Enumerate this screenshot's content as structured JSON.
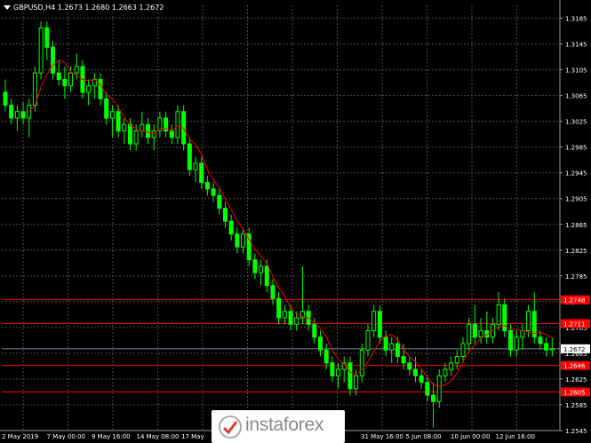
{
  "chart_title": "GBPUSD,H4  1.2673 1.2680 1.2663 1.2672",
  "colors": {
    "background": "#000000",
    "candles": "#00ff00",
    "moving_average": "#ff0000",
    "level_lines": "#ff0000",
    "price_label_bg": "#ff0000",
    "grid": "#4d4d4d",
    "current_price_line": "#778899"
  },
  "watermark_text": "instaforex",
  "watermark_icon": "instaforex-logo-icon",
  "chart_data": {
    "type": "candlestick",
    "symbol": "GBPUSD",
    "timeframe": "H4",
    "ohlc_header": {
      "open": 1.2673,
      "high": 1.268,
      "low": 1.2663,
      "close": 1.2672
    },
    "ylim": [
      1.2545,
      1.3205
    ],
    "y_ticks": [
      "1.3185",
      "1.3145",
      "1.3105",
      "1.3065",
      "1.3025",
      "1.2985",
      "1.2945",
      "1.2905",
      "1.2865",
      "1.2825",
      "1.2785",
      "1.2745",
      "1.2705",
      "1.2665",
      "1.2625",
      "1.2585",
      "1.2545"
    ],
    "x_ticks": [
      "2 May 2019",
      "7 May 00:00",
      "9 May 16:00",
      "14 May 08:00",
      "17 May",
      "",
      "",
      "",
      "31 May 16:00",
      "5 Jun 08:00",
      "10 Jun 00:00",
      "12 Jun 16:00"
    ],
    "current_price": "1.2672",
    "levels": [
      {
        "price": 1.2748,
        "label": "1.2748"
      },
      {
        "price": 1.2711,
        "label": "1.2711"
      },
      {
        "price": 1.2646,
        "label": "1.2646"
      },
      {
        "price": 1.2605,
        "label": "1.2605"
      }
    ],
    "candles": [
      [
        1.307,
        1.309,
        1.304,
        1.305
      ],
      [
        1.305,
        1.306,
        1.302,
        1.303
      ],
      [
        1.303,
        1.305,
        1.301,
        1.304
      ],
      [
        1.304,
        1.3055,
        1.302,
        1.303
      ],
      [
        1.303,
        1.306,
        1.3,
        1.305
      ],
      [
        1.305,
        1.311,
        1.304,
        1.31
      ],
      [
        1.31,
        1.318,
        1.309,
        1.317
      ],
      [
        1.317,
        1.318,
        1.312,
        1.314
      ],
      [
        1.314,
        1.315,
        1.309,
        1.31
      ],
      [
        1.31,
        1.312,
        1.308,
        1.309
      ],
      [
        1.309,
        1.311,
        1.306,
        1.308
      ],
      [
        1.308,
        1.311,
        1.307,
        1.31
      ],
      [
        1.31,
        1.313,
        1.309,
        1.311
      ],
      [
        1.311,
        1.312,
        1.306,
        1.307
      ],
      [
        1.307,
        1.309,
        1.305,
        1.308
      ],
      [
        1.308,
        1.31,
        1.306,
        1.309
      ],
      [
        1.309,
        1.31,
        1.305,
        1.306
      ],
      [
        1.306,
        1.307,
        1.302,
        1.303
      ],
      [
        1.303,
        1.305,
        1.3,
        1.304
      ],
      [
        1.304,
        1.305,
        1.3,
        1.301
      ],
      [
        1.301,
        1.303,
        1.299,
        1.302
      ],
      [
        1.302,
        1.303,
        1.298,
        1.299
      ],
      [
        1.299,
        1.302,
        1.298,
        1.301
      ],
      [
        1.301,
        1.304,
        1.3,
        1.302
      ],
      [
        1.302,
        1.303,
        1.299,
        1.3
      ],
      [
        1.3,
        1.302,
        1.298,
        1.301
      ],
      [
        1.301,
        1.304,
        1.3,
        1.303
      ],
      [
        1.303,
        1.304,
        1.3,
        1.301
      ],
      [
        1.301,
        1.302,
        1.299,
        1.3
      ],
      [
        1.3,
        1.305,
        1.299,
        1.304
      ],
      [
        1.304,
        1.305,
        1.298,
        1.299
      ],
      [
        1.299,
        1.3,
        1.294,
        1.295
      ],
      [
        1.295,
        1.297,
        1.293,
        1.296
      ],
      [
        1.296,
        1.297,
        1.292,
        1.293
      ],
      [
        1.293,
        1.294,
        1.291,
        1.292
      ],
      [
        1.292,
        1.293,
        1.29,
        1.291
      ],
      [
        1.291,
        1.292,
        1.288,
        1.289
      ],
      [
        1.289,
        1.29,
        1.286,
        1.287
      ],
      [
        1.287,
        1.288,
        1.284,
        1.285
      ],
      [
        1.285,
        1.286,
        1.282,
        1.283
      ],
      [
        1.283,
        1.286,
        1.282,
        1.285
      ],
      [
        1.285,
        1.286,
        1.28,
        1.281
      ],
      [
        1.281,
        1.282,
        1.278,
        1.279
      ],
      [
        1.279,
        1.281,
        1.277,
        1.28
      ],
      [
        1.28,
        1.281,
        1.276,
        1.277
      ],
      [
        1.277,
        1.278,
        1.274,
        1.275
      ],
      [
        1.275,
        1.276,
        1.271,
        1.272
      ],
      [
        1.272,
        1.274,
        1.271,
        1.273
      ],
      [
        1.273,
        1.274,
        1.27,
        1.271
      ],
      [
        1.271,
        1.273,
        1.27,
        1.272
      ],
      [
        1.272,
        1.28,
        1.271,
        1.273
      ],
      [
        1.273,
        1.274,
        1.27,
        1.271
      ],
      [
        1.271,
        1.272,
        1.268,
        1.269
      ],
      [
        1.269,
        1.27,
        1.266,
        1.267
      ],
      [
        1.267,
        1.268,
        1.264,
        1.265
      ],
      [
        1.265,
        1.266,
        1.262,
        1.263
      ],
      [
        1.263,
        1.265,
        1.261,
        1.264
      ],
      [
        1.264,
        1.266,
        1.262,
        1.265
      ],
      [
        1.265,
        1.266,
        1.26,
        1.261
      ],
      [
        1.261,
        1.264,
        1.26,
        1.263
      ],
      [
        1.263,
        1.268,
        1.262,
        1.267
      ],
      [
        1.267,
        1.271,
        1.266,
        1.27
      ],
      [
        1.27,
        1.274,
        1.269,
        1.273
      ],
      [
        1.273,
        1.274,
        1.268,
        1.269
      ],
      [
        1.269,
        1.27,
        1.266,
        1.267
      ],
      [
        1.267,
        1.269,
        1.265,
        1.268
      ],
      [
        1.268,
        1.269,
        1.265,
        1.266
      ],
      [
        1.266,
        1.268,
        1.264,
        1.265
      ],
      [
        1.265,
        1.266,
        1.263,
        1.264
      ],
      [
        1.264,
        1.266,
        1.262,
        1.263
      ],
      [
        1.263,
        1.264,
        1.261,
        1.262
      ],
      [
        1.262,
        1.263,
        1.259,
        1.26
      ],
      [
        1.26,
        1.262,
        1.255,
        1.259
      ],
      [
        1.259,
        1.264,
        1.258,
        1.263
      ],
      [
        1.263,
        1.265,
        1.262,
        1.264
      ],
      [
        1.264,
        1.266,
        1.263,
        1.265
      ],
      [
        1.265,
        1.267,
        1.264,
        1.266
      ],
      [
        1.266,
        1.269,
        1.265,
        1.268
      ],
      [
        1.268,
        1.272,
        1.267,
        1.271
      ],
      [
        1.271,
        1.274,
        1.268,
        1.269
      ],
      [
        1.269,
        1.272,
        1.268,
        1.27
      ],
      [
        1.27,
        1.273,
        1.268,
        1.269
      ],
      [
        1.269,
        1.272,
        1.268,
        1.271
      ],
      [
        1.271,
        1.276,
        1.27,
        1.274
      ],
      [
        1.274,
        1.275,
        1.269,
        1.27
      ],
      [
        1.27,
        1.271,
        1.266,
        1.267
      ],
      [
        1.267,
        1.27,
        1.266,
        1.269
      ],
      [
        1.269,
        1.271,
        1.267,
        1.27
      ],
      [
        1.27,
        1.274,
        1.269,
        1.273
      ],
      [
        1.273,
        1.276,
        1.268,
        1.269
      ],
      [
        1.269,
        1.27,
        1.267,
        1.268
      ],
      [
        1.268,
        1.269,
        1.266,
        1.267
      ],
      [
        1.267,
        1.269,
        1.266,
        1.2672
      ]
    ]
  }
}
